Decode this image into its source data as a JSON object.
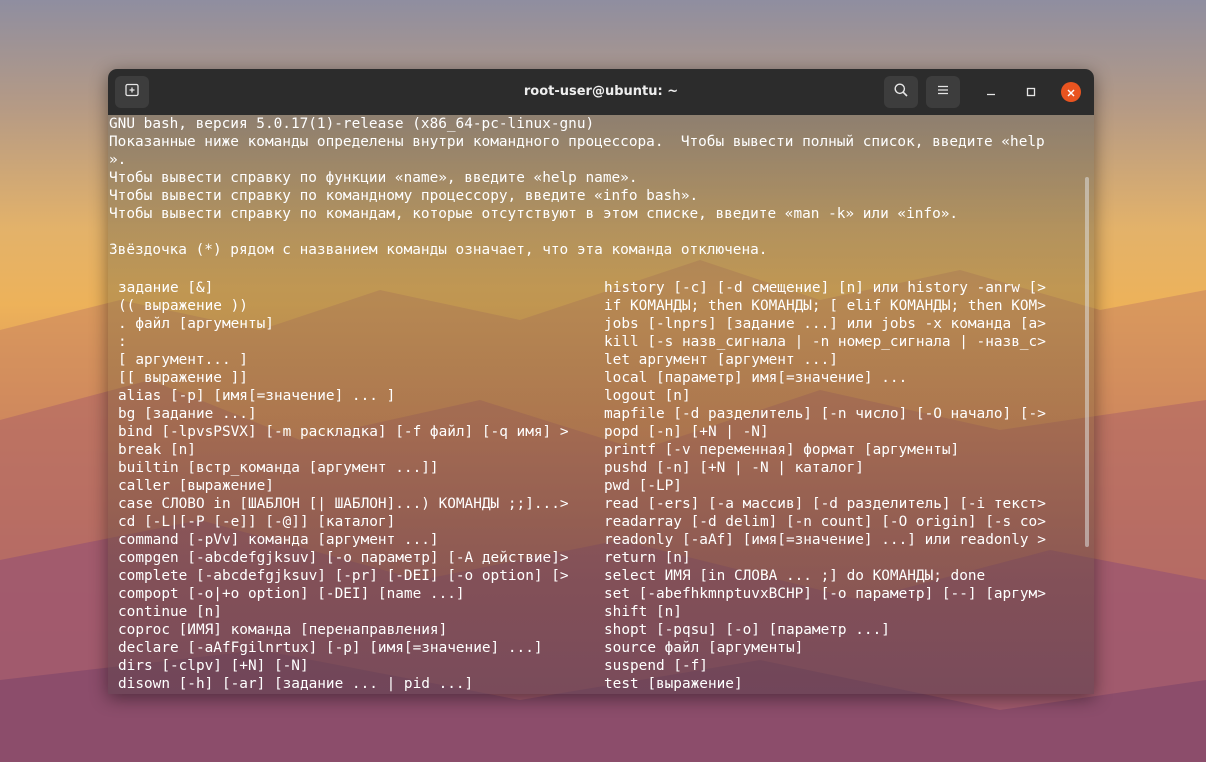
{
  "window": {
    "title": "root-user@ubuntu: ~"
  },
  "icons": {
    "new_tab": "new-tab-icon",
    "search": "search-icon",
    "menu": "hamburger-menu-icon",
    "minimize": "minimize-icon",
    "maximize": "maximize-icon",
    "close": "close-icon"
  },
  "colors": {
    "titlebar": "#2c2c2c",
    "close_button": "#e95420",
    "text": "#ffffff"
  },
  "terminal": {
    "header_lines": [
      "GNU bash, версия 5.0.17(1)-release (x86_64-pc-linux-gnu)",
      "Показанные ниже команды определены внутри командного процессора.  Чтобы вывести полный список, введите «help",
      "».",
      "Чтобы вывести справку по функции «name», введите «help name».",
      "Чтобы вывести справку по командному процессору, введите «info bash».",
      "Чтобы вывести справку по командам, которые отсутствуют в этом списке, введите «man -k» или «info».",
      "",
      "Звёздочка (*) рядом с названием команды означает, что эта команда отключена.",
      ""
    ],
    "left_column": [
      "задание [&]",
      "(( выражение ))",
      ". файл [аргументы]",
      ":",
      "[ аргумент... ]",
      "[[ выражение ]]",
      "alias [-p] [имя[=значение] ... ]",
      "bg [задание ...]",
      "bind [-lpvsPSVX] [-m раскладка] [-f файл] [-q имя] >",
      "break [n]",
      "builtin [встр_команда [аргумент ...]]",
      "caller [выражение]",
      "case СЛОВО in [ШАБЛОН [| ШАБЛОН]...) КОМАНДЫ ;;]...>",
      "cd [-L|[-P [-e]] [-@]] [каталог]",
      "command [-pVv] команда [аргумент ...]",
      "compgen [-abcdefgjksuv] [-o параметр] [-A действие]>",
      "complete [-abcdefgjksuv] [-pr] [-DEI] [-o option] [>",
      "compopt [-o|+o option] [-DEI] [name ...]",
      "continue [n]",
      "coproc [ИМЯ] команда [перенаправления]",
      "declare [-aAfFgilnrtux] [-p] [имя[=значение] ...]",
      "dirs [-clpv] [+N] [-N]",
      "disown [-h] [-ar] [задание ... | pid ...]"
    ],
    "right_column": [
      "history [-c] [-d смещение] [n] или history -anrw [>",
      "if КОМАНДЫ; then КОМАНДЫ; [ elif КОМАНДЫ; then КОМ>",
      "jobs [-lnprs] [задание ...] или jobs -x команда [a>",
      "kill [-s назв_сигнала | -n номер_сигнала | -назв_c>",
      "let аргумент [аргумент ...]",
      "local [параметр] имя[=значение] ...",
      "logout [n]",
      "mapfile [-d разделитель] [-n число] [-O начало] [->",
      "popd [-n] [+N | -N]",
      "printf [-v переменная] формат [аргументы]",
      "pushd [-n] [+N | -N | каталог]",
      "pwd [-LP]",
      "read [-ers] [-a массив] [-d разделитель] [-i текст>",
      "readarray [-d delim] [-n count] [-O origin] [-s co>",
      "readonly [-aAf] [имя[=значение] ...] или readonly >",
      "return [n]",
      "select ИМЯ [in СЛОВА ... ;] do КОМАНДЫ; done",
      "set [-abefhkmnptuvxBCHP] [-o параметр] [--] [аргум>",
      "shift [n]",
      "shopt [-pqsu] [-o] [параметр ...]",
      "source файл [аргументы]",
      "suspend [-f]",
      "test [выражение]"
    ]
  }
}
